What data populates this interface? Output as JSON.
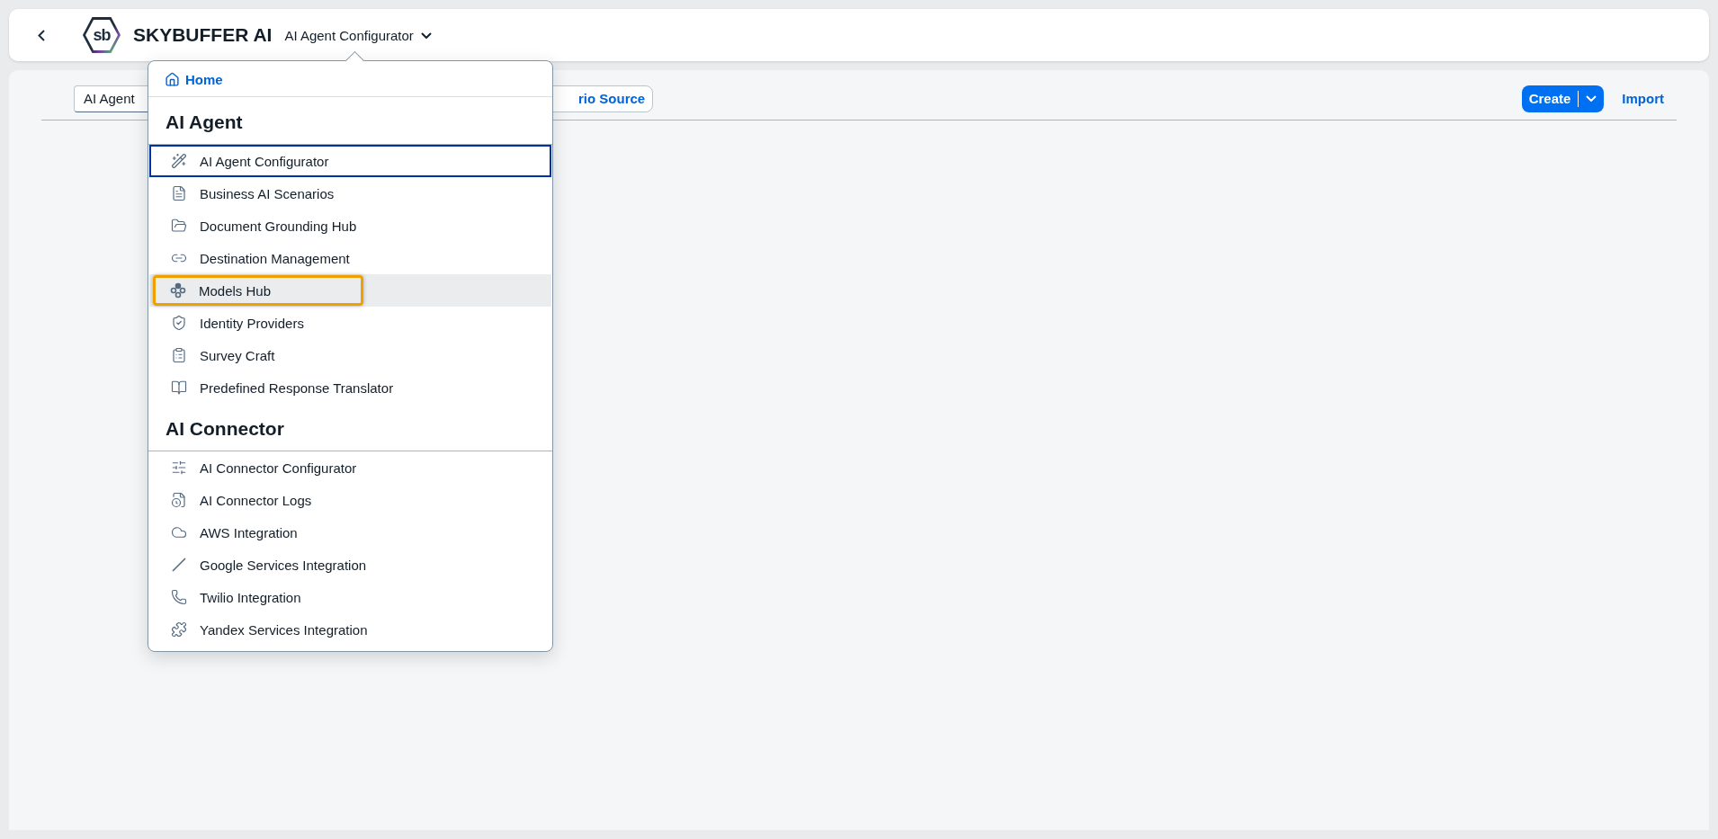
{
  "header": {
    "logo_text": "sb",
    "brand": "SKYBUFFER AI",
    "app_title": "AI Agent Configurator"
  },
  "toolbar": {
    "field_value": "AI Agent",
    "source_button": "rio Source",
    "create_button": "Create",
    "import_link": "Import"
  },
  "menu": {
    "home": "Home",
    "sections": [
      {
        "heading": "AI Agent",
        "items": [
          {
            "label": "AI Agent Configurator",
            "focused": true,
            "hovered": false
          },
          {
            "label": "Business AI Scenarios",
            "focused": false,
            "hovered": false
          },
          {
            "label": "Document Grounding Hub",
            "focused": false,
            "hovered": false
          },
          {
            "label": "Destination Management",
            "focused": false,
            "hovered": false
          },
          {
            "label": "Models Hub",
            "focused": false,
            "hovered": true
          },
          {
            "label": "Identity Providers",
            "focused": false,
            "hovered": false
          },
          {
            "label": "Survey Craft",
            "focused": false,
            "hovered": false
          },
          {
            "label": "Predefined Response Translator",
            "focused": false,
            "hovered": false
          }
        ]
      },
      {
        "heading": "AI Connector",
        "items": [
          {
            "label": "AI Connector Configurator",
            "focused": false,
            "hovered": false
          },
          {
            "label": "AI Connector Logs",
            "focused": false,
            "hovered": false
          },
          {
            "label": "AWS Integration",
            "focused": false,
            "hovered": false
          },
          {
            "label": "Google Services Integration",
            "focused": false,
            "hovered": false
          },
          {
            "label": "Twilio Integration",
            "focused": false,
            "hovered": false
          },
          {
            "label": "Yandex Services Integration",
            "focused": false,
            "hovered": false
          }
        ]
      }
    ]
  }
}
